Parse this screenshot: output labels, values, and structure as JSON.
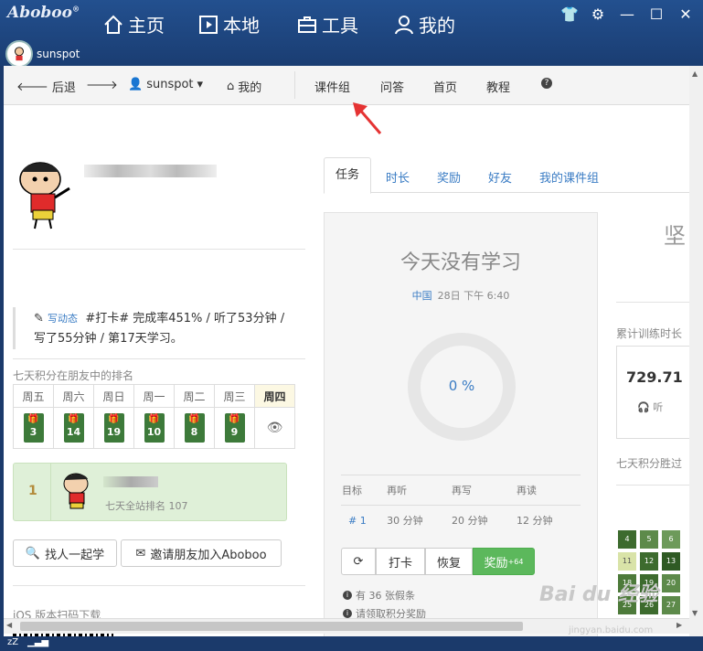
{
  "app": {
    "logo": "Aboboo",
    "logo_mark": "®"
  },
  "nav": [
    {
      "label": "主页",
      "icon": "home-icon"
    },
    {
      "label": "本地",
      "icon": "play-window-icon"
    },
    {
      "label": "工具",
      "icon": "toolbox-icon"
    },
    {
      "label": "我的",
      "icon": "person-icon"
    }
  ],
  "user": {
    "name": "sunspot"
  },
  "window_controls": [
    "shirt-icon",
    "gear-icon",
    "minimize-icon",
    "maximize-icon",
    "close-icon"
  ],
  "browser": {
    "back": "后退",
    "user": "sunspot",
    "mine": "我的",
    "links": [
      "课件组",
      "问答",
      "首页",
      "教程"
    ]
  },
  "status": {
    "tag": "写动态",
    "text_line1": "#打卡# 完成率451% / 听了53分钟 /",
    "text_line2": "写了55分钟 / 第17天学习。"
  },
  "ranking": {
    "title": "七天积分在朋友中的排名",
    "days": [
      "周五",
      "周六",
      "周日",
      "周一",
      "周二",
      "周三",
      "周四"
    ],
    "values": [
      "3",
      "14",
      "19",
      "10",
      "8",
      "9"
    ],
    "rank": "1",
    "site_rank": "七天全站排名 107"
  },
  "buttons": {
    "find": "找人一起学",
    "invite": "邀请朋友加入Aboboo"
  },
  "ios": "iOS 版本扫码下载",
  "tabs": [
    "任务",
    "时长",
    "奖励",
    "好友",
    "我的课件组"
  ],
  "today": {
    "title": "今天没有学习",
    "city": "中国",
    "time": "28日 下午 6:40",
    "percent": "0 %",
    "headers": [
      "目标",
      "再听",
      "再写",
      "再读"
    ],
    "row": [
      "# 1",
      "30 分钟",
      "20 分钟",
      "12 分钟"
    ],
    "actions": {
      "checkin": "打卡",
      "restore": "恢复",
      "reward": "奖励",
      "reward_sup": "+64"
    },
    "note1": "有 36 张假条",
    "note2": "请领取积分奖励"
  },
  "right": {
    "big": "坚",
    "cumulative": "累计训练时长",
    "value": "729.71",
    "listen": "听",
    "seven_day": "七天积分胜过"
  },
  "calendar": [
    "4",
    "5",
    "6",
    "11",
    "12",
    "13",
    "18",
    "19",
    "20",
    "25",
    "26",
    "27"
  ],
  "watermark": {
    "logo": "Bai du 经验",
    "url": "jingyan.baidu.com"
  },
  "statusbar": {
    "signal": "zZ"
  }
}
